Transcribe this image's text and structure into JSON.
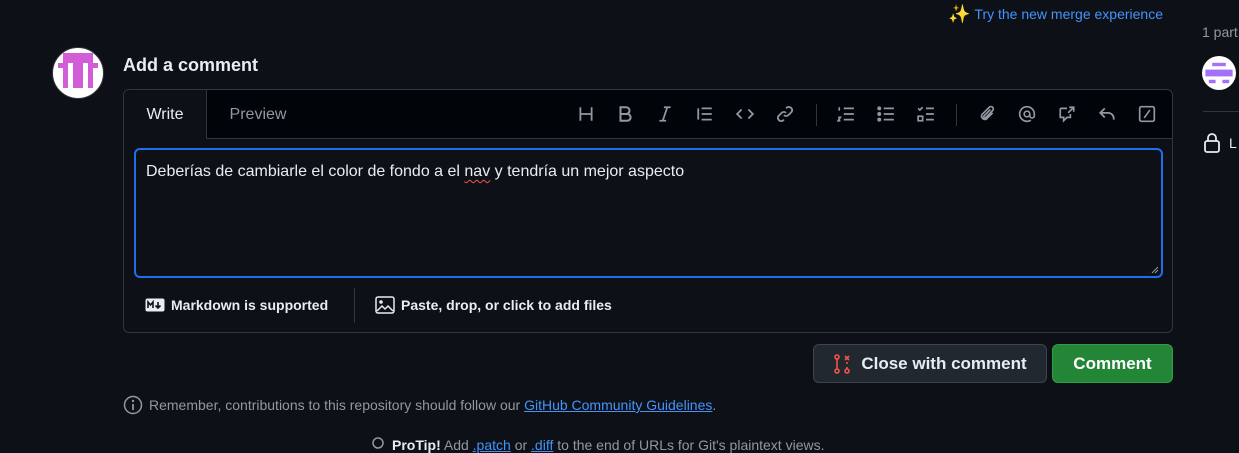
{
  "merge_banner": {
    "icon": "sparkles-icon",
    "label": "Try the new merge experience"
  },
  "comment_form": {
    "heading": "Add a comment",
    "tabs": [
      {
        "label": "Write",
        "active": true
      },
      {
        "label": "Preview",
        "active": false
      }
    ],
    "toolbar": [
      "heading-icon",
      "bold-icon",
      "italic-icon",
      "quote-icon",
      "code-icon",
      "link-icon",
      "numbered-list-icon",
      "unordered-list-icon",
      "task-list-icon",
      "attach-icon",
      "mention-icon",
      "cross-reference-icon",
      "reply-icon",
      "slash-commands-icon"
    ],
    "text": {
      "before": "Deberías de cambiarle el color de fondo a el ",
      "misspelled": "nav",
      "after": " y tendría un mejor aspecto"
    },
    "markdown_label": "Markdown is supported",
    "files_label": "Paste, drop, or click to add files"
  },
  "buttons": {
    "close_label": "Close with comment",
    "comment_label": "Comment"
  },
  "guidelines": {
    "before": "Remember, contributions to this repository should follow our ",
    "link": "GitHub Community Guidelines",
    "after": "."
  },
  "protip": {
    "bold": "ProTip!",
    "before": " Add ",
    "patch": ".patch",
    "or": " or ",
    "diff": ".diff",
    "after": " to the end of URLs for Git's plaintext views."
  },
  "sidebar": {
    "participants": "1 part",
    "lock_label": "L"
  },
  "colors": {
    "accent_blue": "#4493f8",
    "comment_green": "#238636",
    "focus_border": "#1f6feb",
    "avatar_pink": "#d35dd6",
    "background": "#0d1117"
  }
}
